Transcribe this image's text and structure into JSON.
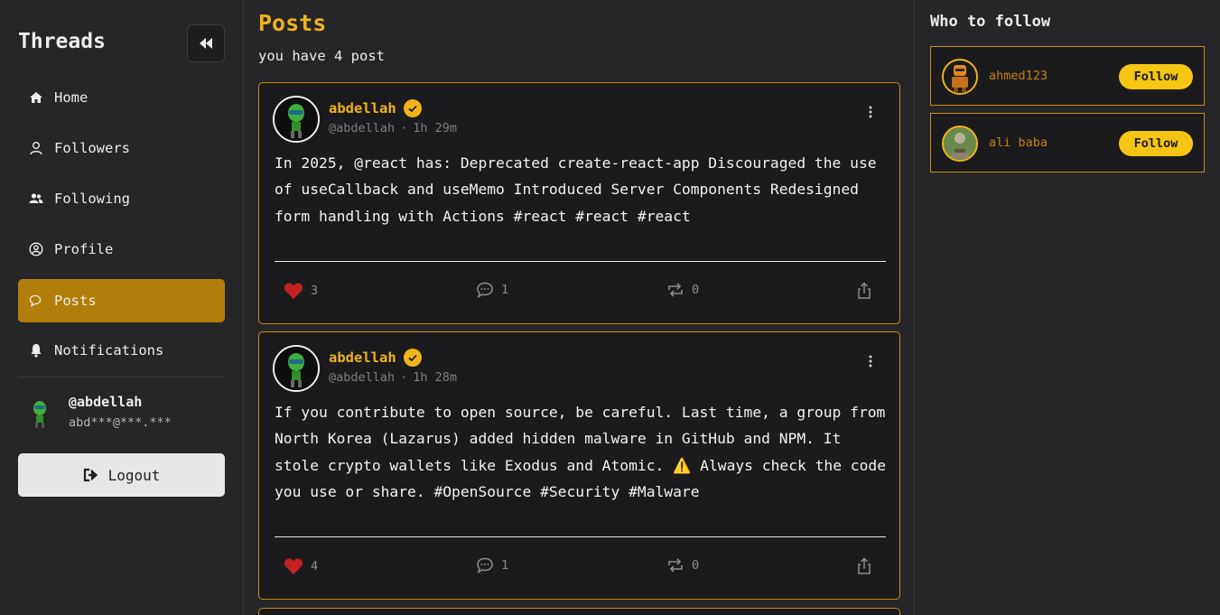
{
  "app": {
    "title": "Threads"
  },
  "sidebar": {
    "items": [
      {
        "label": "Home",
        "icon": "home-icon"
      },
      {
        "label": "Followers",
        "icon": "user-icon"
      },
      {
        "label": "Following",
        "icon": "users-icon"
      },
      {
        "label": "Profile",
        "icon": "user-circle-icon"
      },
      {
        "label": "Posts",
        "icon": "chat-icon",
        "active": true
      },
      {
        "label": "Notifications",
        "icon": "bell-icon"
      }
    ],
    "user": {
      "handle": "@abdellah",
      "email": "abd***@***.***"
    },
    "logout_label": "Logout"
  },
  "main": {
    "title": "Posts",
    "count_text": "you have 4 post",
    "posts": [
      {
        "author": "abdellah",
        "handle": "@abdellah",
        "time": "1h 29m",
        "text": "In 2025, @react has: Deprecated create-react-app Discouraged the use of useCallback and useMemo Introduced Server Components Redesigned form handling with Actions #react #react #react",
        "likes": "3",
        "comments": "1",
        "reposts": "0"
      },
      {
        "author": "abdellah",
        "handle": "@abdellah",
        "time": "1h 28m",
        "text": "If you contribute to open source, be careful. Last time, a group from North Korea (Lazarus) added hidden malware in GitHub and NPM. It stole crypto wallets like Exodus and Atomic. ⚠️ Always check the code you use or share. #OpenSource #Security #Malware",
        "likes": "4",
        "comments": "1",
        "reposts": "0"
      }
    ]
  },
  "right": {
    "title": "Who to follow",
    "suggestions": [
      {
        "name": "ahmed123",
        "button": "Follow"
      },
      {
        "name": "ali baba",
        "button": "Follow"
      }
    ]
  },
  "colors": {
    "accent": "#f0b41a",
    "active_nav": "#b37d0b",
    "card_border": "#c98a14",
    "like": "#c42121"
  }
}
